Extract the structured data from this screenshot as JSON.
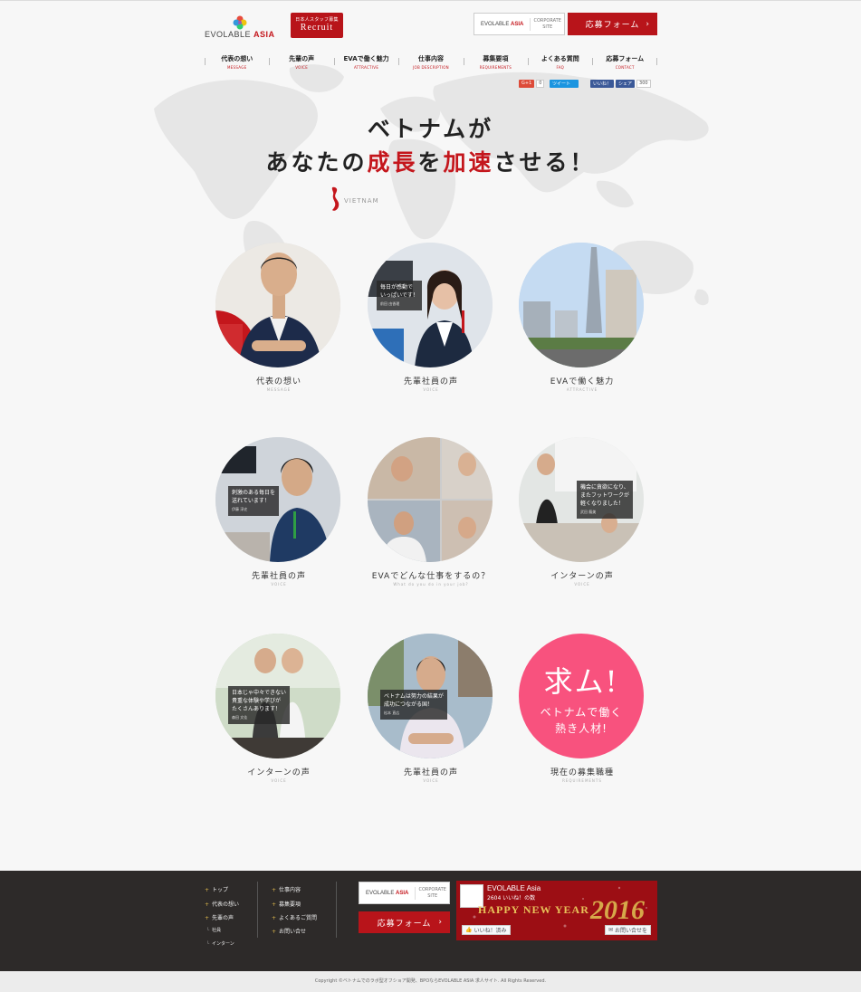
{
  "header": {
    "logo_main": "EVOLABLE",
    "logo_accent": "ASIA",
    "recruit_small": "日本人スタッフ募集",
    "recruit_big": "Recruit",
    "corporate_logo_main": "EVOLABLE",
    "corporate_logo_accent": "ASIA",
    "corporate_line1": "CORPORATE",
    "corporate_line2": "SITE",
    "apply_label": "応募フォーム",
    "apply_chevron": "›"
  },
  "nav": [
    {
      "jp": "代表の想い",
      "en": "MESSAGE"
    },
    {
      "jp": "先輩の声",
      "en": "VOICE"
    },
    {
      "jp": "EVAで働く魅力",
      "en": "ATTRACTIVE"
    },
    {
      "jp": "仕事内容",
      "en": "JOB DESCRIPTION"
    },
    {
      "jp": "募集要項",
      "en": "REQUIREMENTS"
    },
    {
      "jp": "よくある質問",
      "en": "FAQ"
    },
    {
      "jp": "応募フォーム",
      "en": "CONTACT"
    }
  ],
  "social": {
    "gplus": "G+1",
    "gplus_count": "0",
    "tweet": "ツイート",
    "fb_like": "いいね！",
    "fb_share": "シェア",
    "fb_count": "300"
  },
  "hero": {
    "line1": "ベトナムが",
    "line2_pre": "あなたの",
    "line2_red1": "成長",
    "line2_mid1": "を",
    "line2_red2": "加速",
    "line2_post": "させる！",
    "vietnam_label": "VIETNAM"
  },
  "cards": [
    {
      "title": "代表の想い",
      "sub": "MESSAGE"
    },
    {
      "title": "先輩社員の声",
      "sub": "VOICE",
      "caption": "毎日が感動で\nいっぱいです！",
      "caption_name": "前田 由香理"
    },
    {
      "title": "EVAで働く魅力",
      "sub": "ATTRACTIVE"
    },
    {
      "title": "先輩社員の声",
      "sub": "VOICE",
      "caption": "刺激のある毎日を\n送れています！",
      "caption_name": "伊藤 淳史"
    },
    {
      "title": "EVAでどんな仕事をするの？",
      "sub": "What do you do in your job?"
    },
    {
      "title": "インターンの声",
      "sub": "VOICE",
      "caption": "機会に貪欲になり、\nまたフットワークが\n軽くなりました！",
      "caption_name": "武田 龍美"
    },
    {
      "title": "インターンの声",
      "sub": "VOICE",
      "caption": "日本じゃ中々できない\n貴重な体験や学びが\nたくさんあります！",
      "caption_name": "森田 文佳"
    },
    {
      "title": "先輩社員の声",
      "sub": "VOICE",
      "caption": "ベトナムは努力の結果が\n成功につながる国！",
      "caption_name": "松本 直広"
    },
    {
      "title": "現在の募集職種",
      "sub": "REQUIREMENTS",
      "pink_big": "求ム!",
      "pink_l1": "ベトナムで働く",
      "pink_l2": "熱き人材!"
    }
  ],
  "footer": {
    "col1": [
      "トップ",
      "代表の想い",
      "先輩の声"
    ],
    "col1_sub": [
      "社員",
      "インターン"
    ],
    "col2": [
      "仕事内容",
      "募集要項",
      "よくあるご質問",
      "お問い合せ"
    ],
    "corporate_logo_main": "EVOLABLE",
    "corporate_logo_accent": "ASIA",
    "corporate_line1": "CORPORATE",
    "corporate_line2": "SITE",
    "apply_label": "応募フォーム",
    "apply_chevron": "›",
    "fb_name": "EVOLABLE Asia",
    "fb_likes": "2604 いいね！の数",
    "fb_banner": "HAPPY NEW YEAR",
    "fb_year": "2016",
    "fb_like_btn": "いいね！済み",
    "fb_msg_btn": "お問い合せを"
  },
  "copyright": "Copyright ©ベトナムでのラボ型オフショア開発、BPOならEVOLABLE ASIA 求人サイト. All Rights Reserved.",
  "colors": {
    "brand_red": "#b8141a",
    "pink": "#f8527e",
    "footer_bg": "#2d2a29"
  }
}
